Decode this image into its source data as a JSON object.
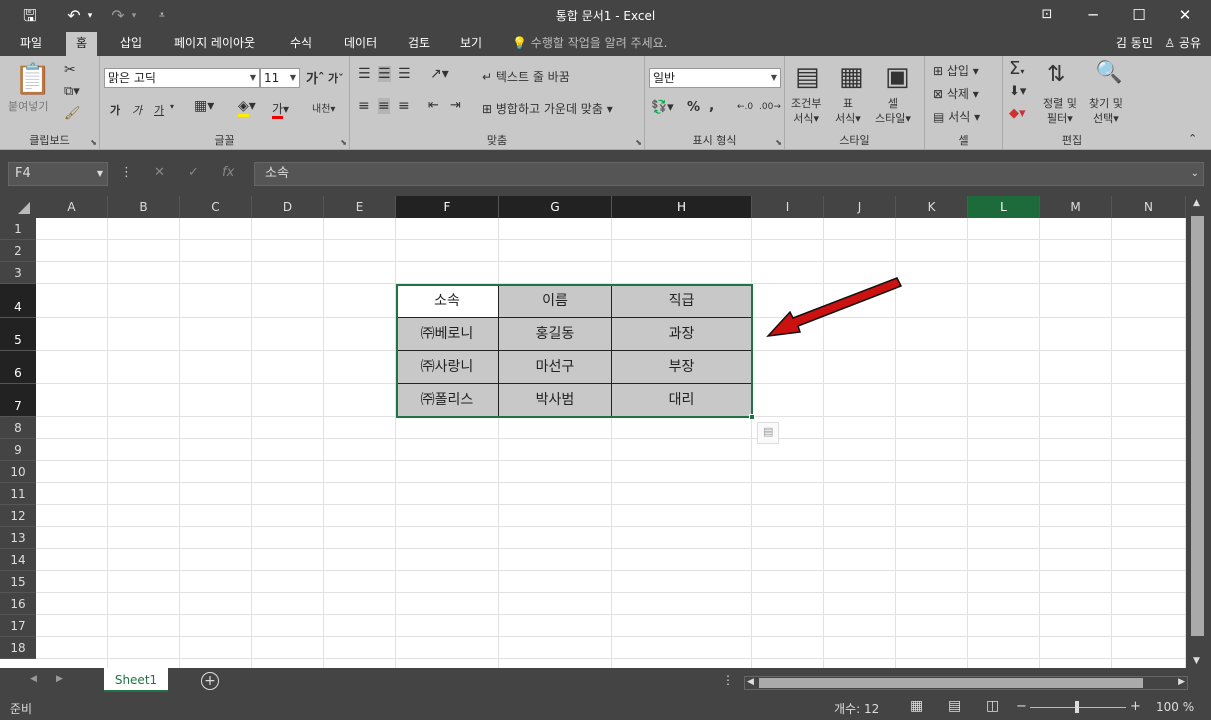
{
  "window": {
    "title": "통합 문서1 - Excel",
    "save_icon": "save-icon",
    "undo_icon": "undo-icon",
    "redo_icon": "redo-icon"
  },
  "tabs": [
    "파일",
    "홈",
    "삽입",
    "페이지 레이아웃",
    "수식",
    "데이터",
    "검토",
    "보기"
  ],
  "active_tab": "홈",
  "tell_me": "수행할 작업을 알려 주세요.",
  "user": "김 동민",
  "share": "공유",
  "ribbon": {
    "clipboard": {
      "label": "클립보드",
      "paste": "붙여넣기"
    },
    "font": {
      "label": "글꼴",
      "font_name": "맑은 고딕",
      "font_size": "11",
      "bold": "가",
      "italic": "가",
      "underline": "가",
      "font_color": "가",
      "phonetic": "내천"
    },
    "align": {
      "label": "맞춤",
      "wrap": "텍스트 줄 바꿈",
      "merge": "병합하고 가운데 맞춤"
    },
    "number": {
      "label": "표시 형식",
      "format": "일반",
      "percent": "%",
      "comma": ","
    },
    "styles": {
      "label": "스타일",
      "cond1": "조건부",
      "cond2": "서식",
      "table1": "표",
      "table2": "서식",
      "cell1": "셀",
      "cell2": "스타일"
    },
    "cells": {
      "label": "셀",
      "insert": "삽입",
      "delete": "삭제",
      "format": "서식"
    },
    "editing": {
      "label": "편집",
      "sort1": "정렬 및",
      "sort2": "필터",
      "find1": "찾기 및",
      "find2": "선택"
    }
  },
  "formula_bar": {
    "name_box": "F4",
    "fx": "fx",
    "content": "소속"
  },
  "columns": [
    "A",
    "B",
    "C",
    "D",
    "E",
    "F",
    "G",
    "H",
    "I",
    "J",
    "K",
    "L",
    "M",
    "N"
  ],
  "rows": [
    "1",
    "2",
    "3",
    "4",
    "5",
    "6",
    "7",
    "8",
    "9",
    "10",
    "11",
    "12",
    "13",
    "14",
    "15",
    "16",
    "17",
    "18"
  ],
  "table": [
    [
      "소속",
      "이름",
      "직급"
    ],
    [
      "㈜베로니",
      "홍길동",
      "과장"
    ],
    [
      "㈜사랑니",
      "마선구",
      "부장"
    ],
    [
      "㈜폴리스",
      "박사범",
      "대리"
    ]
  ],
  "sheet_tabs": [
    "Sheet1"
  ],
  "status": {
    "ready": "준비",
    "count": "개수: 12",
    "zoom": "100 %"
  },
  "colors": {
    "accent": "#217346",
    "arrow": "#cc1111"
  }
}
